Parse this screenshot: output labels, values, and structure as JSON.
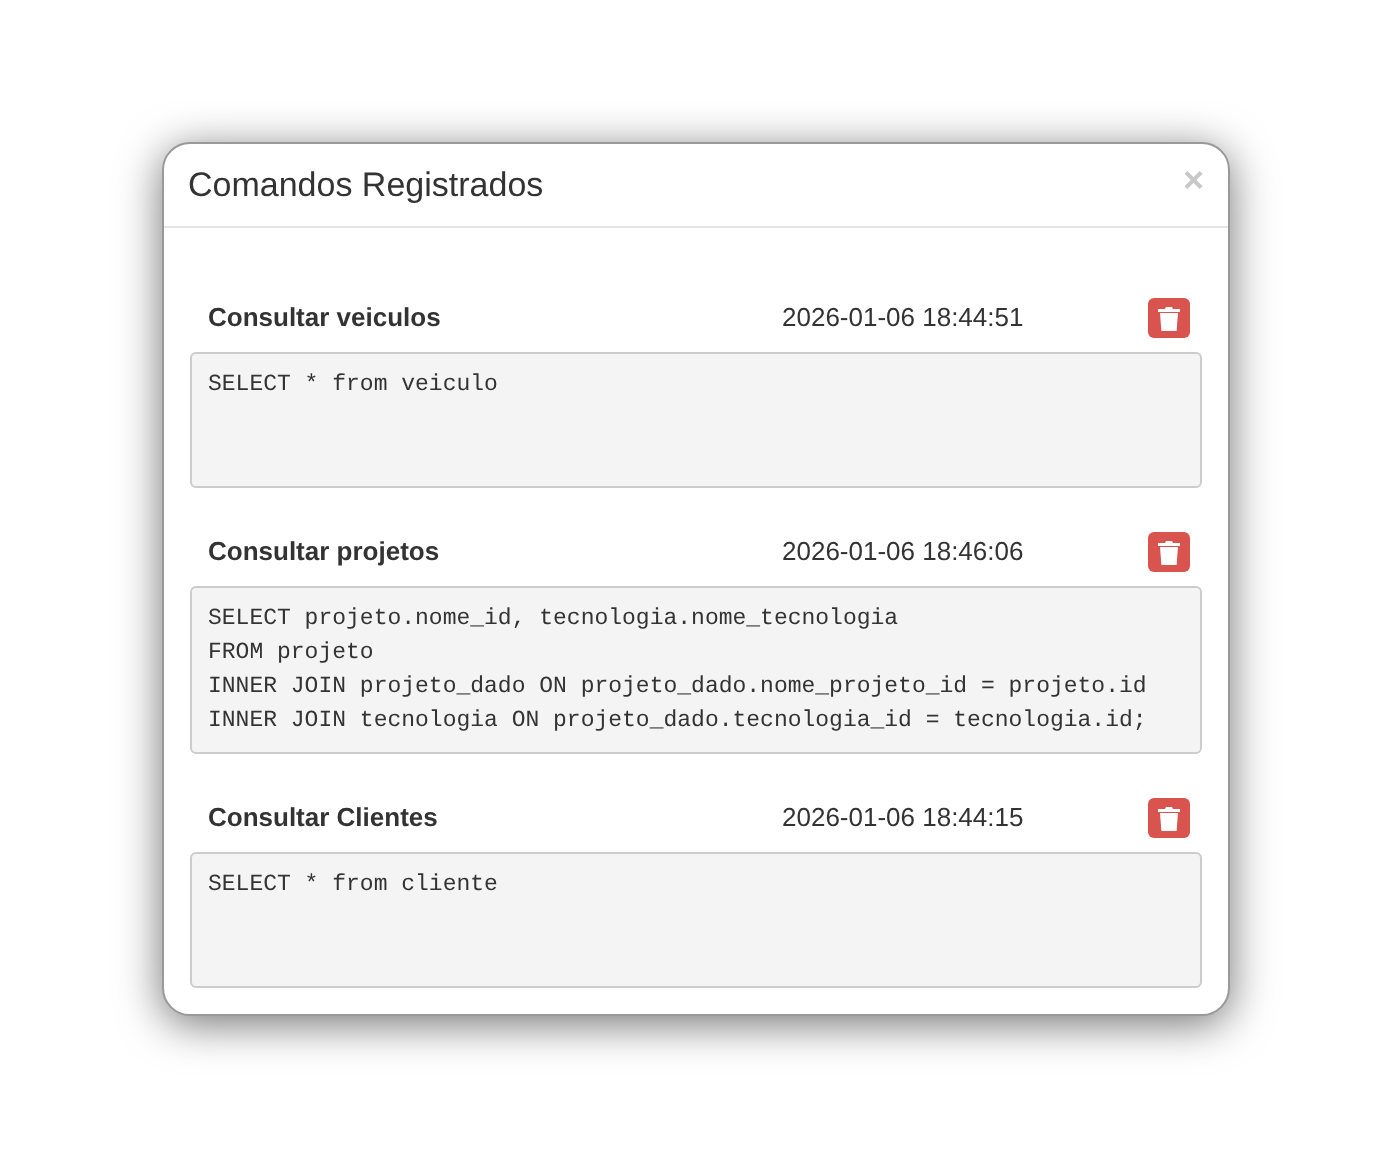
{
  "modal": {
    "title": "Comandos Registrados",
    "close": "×"
  },
  "commands": [
    {
      "name": "Consultar veiculos",
      "timestamp": "2026-01-06 18:44:51",
      "sql": "SELECT * from veiculo"
    },
    {
      "name": "Consultar projetos",
      "timestamp": "2026-01-06 18:46:06",
      "sql": "SELECT projeto.nome_id, tecnologia.nome_tecnologia\nFROM projeto\nINNER JOIN projeto_dado ON projeto_dado.nome_projeto_id = projeto.id\nINNER JOIN tecnologia ON projeto_dado.tecnologia_id = tecnologia.id;"
    },
    {
      "name": "Consultar Clientes",
      "timestamp": "2026-01-06 18:44:15",
      "sql": "SELECT * from cliente"
    }
  ]
}
